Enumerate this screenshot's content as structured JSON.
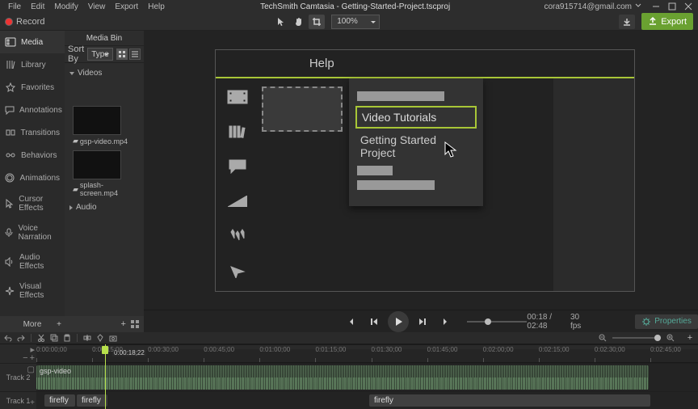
{
  "titlebar": {
    "menu": {
      "file": "File",
      "edit": "Edit",
      "modify": "Modify",
      "view": "View",
      "export": "Export",
      "help": "Help"
    },
    "title": "TechSmith Camtasia - Getting-Started-Project.tscproj",
    "user": "cora915714@gmail.com"
  },
  "toolbar": {
    "record": "Record",
    "zoom": "100%",
    "export": "Export"
  },
  "sidenav": {
    "media": "Media",
    "library": "Library",
    "favorites": "Favorites",
    "annotations": "Annotations",
    "transitions": "Transitions",
    "behaviors": "Behaviors",
    "animations": "Animations",
    "cursor_effects": "Cursor Effects",
    "voice_narration": "Voice Narration",
    "audio_effects": "Audio Effects",
    "visual_effects": "Visual Effects",
    "more": "More"
  },
  "mediabin": {
    "title": "Media Bin",
    "sortby": "Sort By",
    "sortval": "Type",
    "folder_videos": "Videos",
    "file1": "gsp-video.mp4",
    "file2": "splash-screen.mp4",
    "folder_audio": "Audio"
  },
  "canvas": {
    "help_title": "Help",
    "menu_item_highlighted": "Video Tutorials",
    "menu_item_plain": "Getting Started Project"
  },
  "playbar": {
    "time": "00:18 / 02:48",
    "fps": "30 fps",
    "properties": "Properties"
  },
  "timeline": {
    "playhead_time": "0:00:18;22",
    "ticks": [
      "0:00:00;00",
      "0:00:15;00",
      "0:00:30;00",
      "0:00:45;00",
      "0:01:00;00",
      "0:01:15;00",
      "0:01:30;00",
      "0:01:45;00",
      "0:02:00;00",
      "0:02:15;00",
      "0:02:30;00",
      "0:02:45;00"
    ],
    "track2_label": "Track 2",
    "track1_label": "Track 1",
    "clip_wave_label": "gsp-video",
    "clip_a": "firefly",
    "clip_b": "firefly",
    "clip_c": "firefly"
  }
}
